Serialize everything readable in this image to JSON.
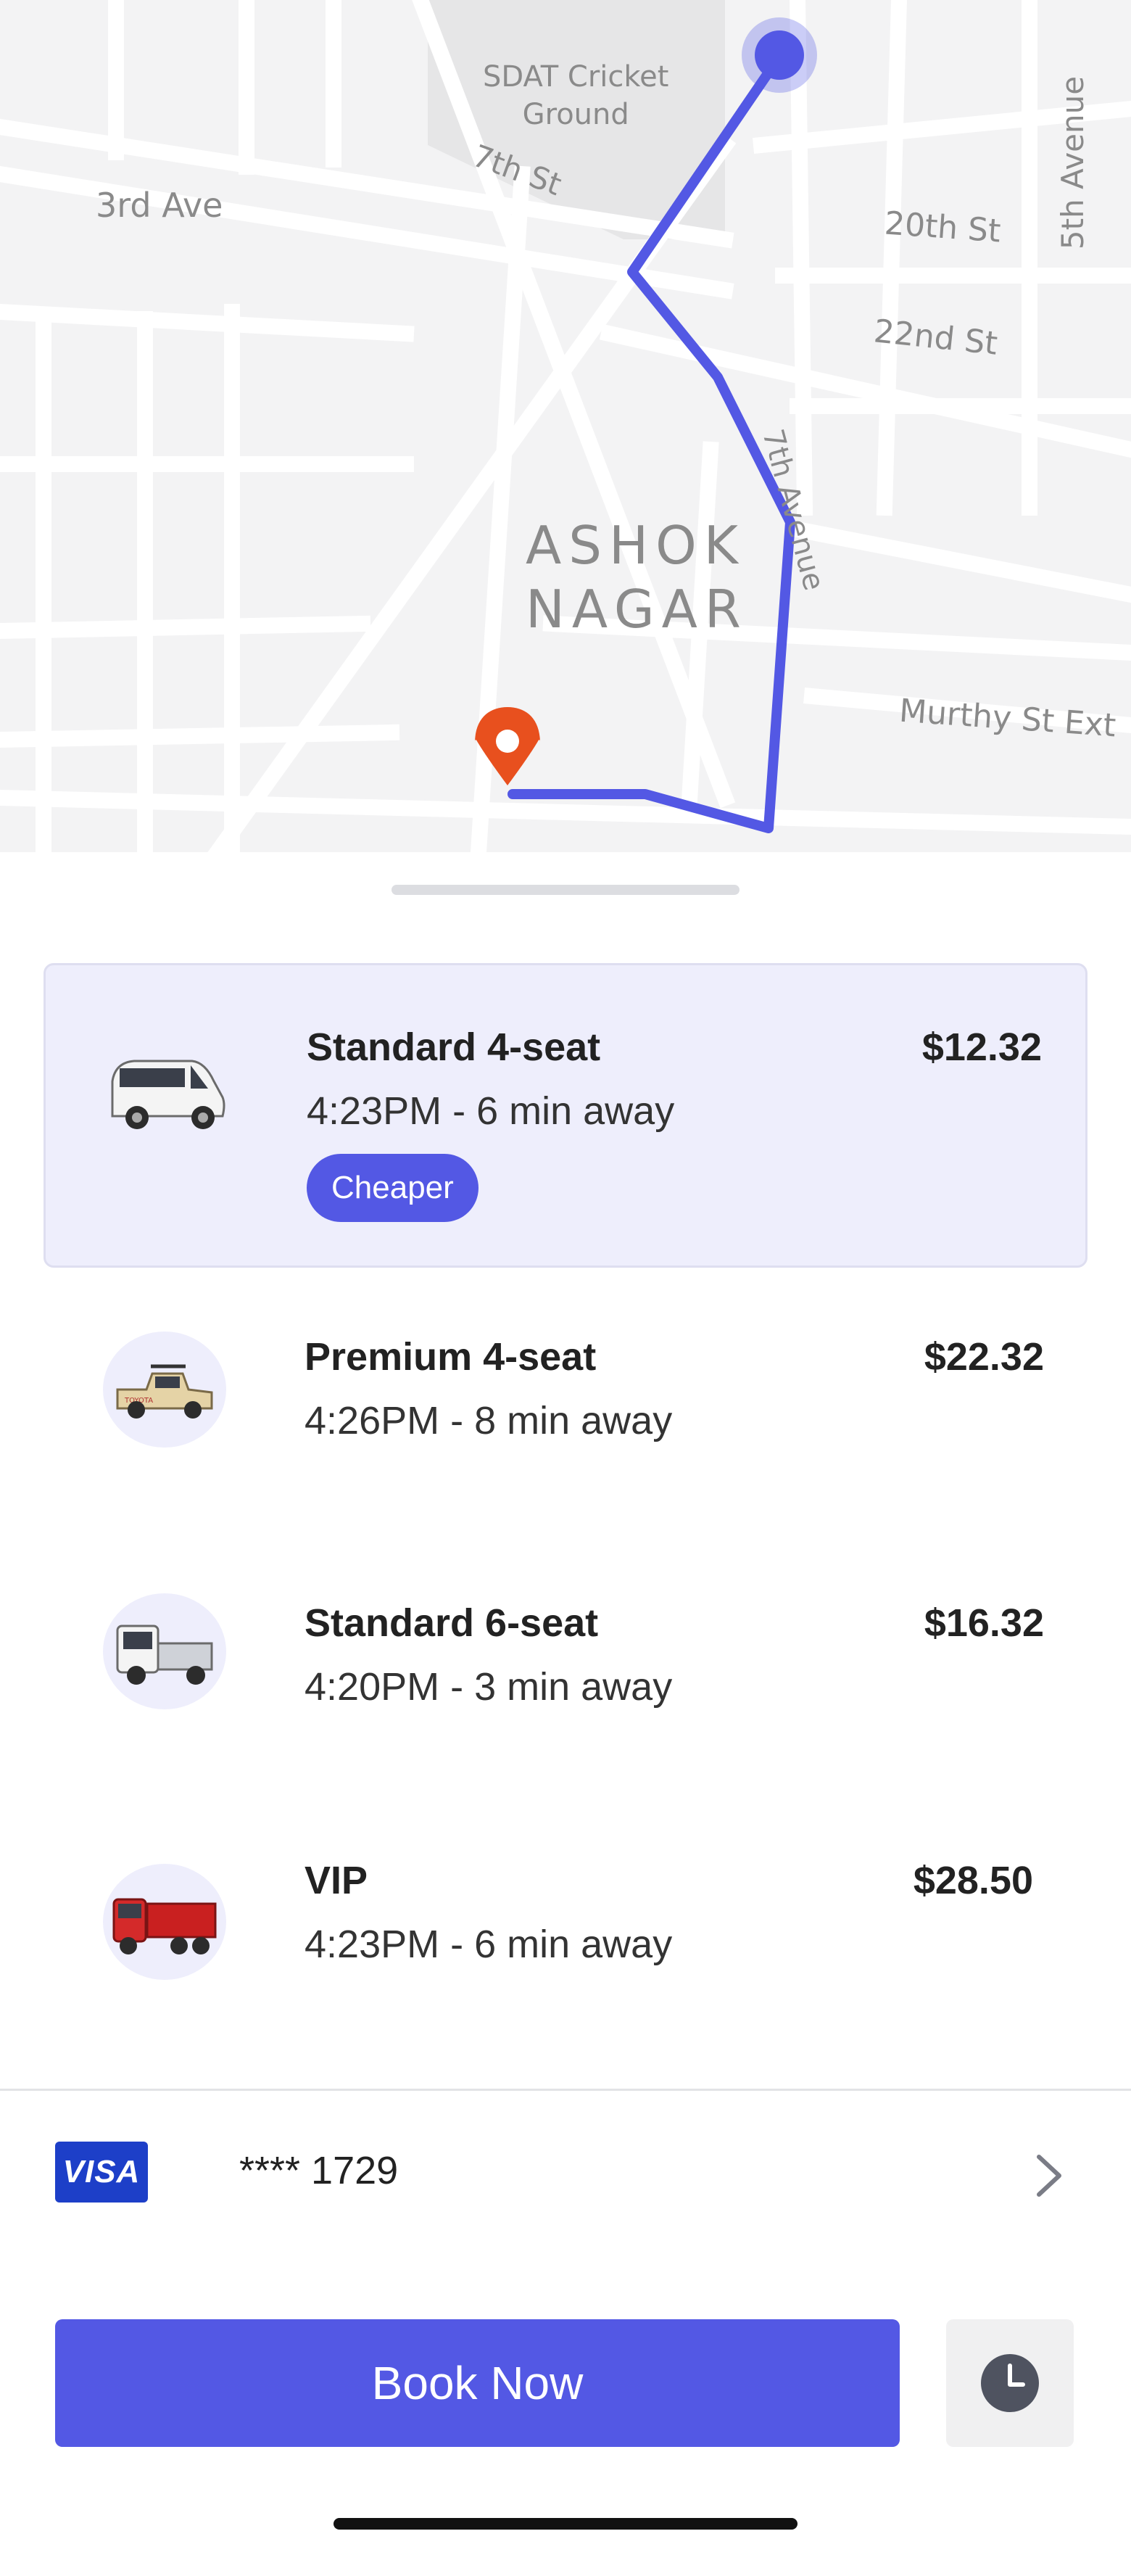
{
  "map": {
    "labels": {
      "sdat": "SDAT Cricket\nGround",
      "third_ave": "3rd Ave",
      "seventh_st": "7th St",
      "twentieth_st": "20th St",
      "twentysecond_st": "22nd St",
      "fifth_avenue": "5th Avenue",
      "seventh_avenue": "7th Avenue",
      "ashok": "ASHOK",
      "nagar": "NAGAR",
      "murthy": "Murthy St Ext"
    },
    "route_color": "#5358e4",
    "destination_pin_color": "#e8501e"
  },
  "rides": [
    {
      "name": "Standard 4-seat",
      "time": "4:23PM - 6 min away",
      "price": "$12.32",
      "badge": "Cheaper",
      "selected": true,
      "vehicle_icon": "van-icon"
    },
    {
      "name": "Premium 4-seat",
      "time": "4:26PM - 8 min away",
      "price": "$22.32",
      "selected": false,
      "vehicle_icon": "pickup-truck-icon"
    },
    {
      "name": "Standard 6-seat",
      "time": "4:20PM - 3 min away",
      "price": "$16.32",
      "selected": false,
      "vehicle_icon": "light-truck-icon"
    },
    {
      "name": "VIP",
      "time": "4:23PM - 6 min away",
      "price": "$28.50",
      "selected": false,
      "vehicle_icon": "dump-truck-icon"
    }
  ],
  "payment": {
    "brand": "VISA",
    "card_number": "**** 1729"
  },
  "actions": {
    "book_label": "Book Now",
    "schedule_icon": "clock-icon"
  },
  "colors": {
    "accent": "#5358e4",
    "selected_bg": "#eeeefc",
    "visa_blue": "#1d3fc8"
  }
}
